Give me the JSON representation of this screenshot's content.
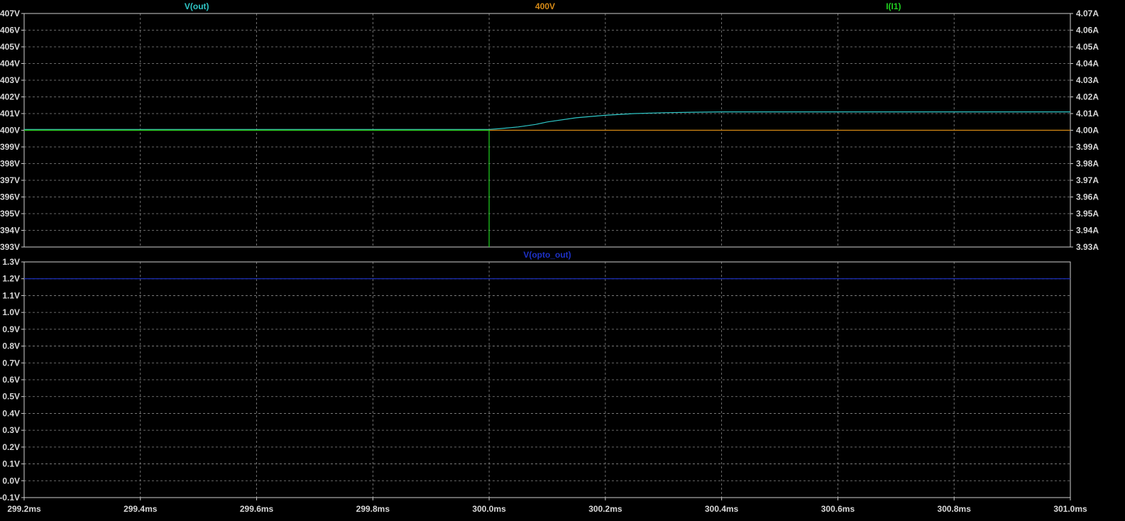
{
  "chart_data": [
    {
      "type": "line",
      "panel": "top",
      "x_unit": "ms",
      "xlim": [
        299.2,
        301.0
      ],
      "ylim_left": [
        393,
        407
      ],
      "ylim_right": [
        3.93,
        4.07
      ],
      "y_ticks_left": [
        "407V",
        "406V",
        "405V",
        "404V",
        "403V",
        "402V",
        "401V",
        "400V",
        "399V",
        "398V",
        "397V",
        "396V",
        "395V",
        "394V",
        "393V"
      ],
      "y_ticks_right": [
        "4.07A",
        "4.06A",
        "4.05A",
        "4.04A",
        "4.03A",
        "4.02A",
        "4.01A",
        "4.00A",
        "3.99A",
        "3.98A",
        "3.97A",
        "3.96A",
        "3.95A",
        "3.94A",
        "3.93A"
      ],
      "grid": true,
      "series": [
        {
          "name": "V(out)",
          "axis": "left",
          "color": "#2fc7c7",
          "x": [
            299.2,
            299.3,
            299.4,
            299.5,
            299.6,
            299.7,
            299.8,
            299.9,
            300.0,
            300.02,
            300.05,
            300.08,
            300.1,
            300.15,
            300.2,
            300.25,
            300.3,
            300.35,
            300.4,
            300.6,
            300.8,
            301.0
          ],
          "y": [
            400.05,
            400.05,
            400.05,
            400.05,
            400.05,
            400.05,
            400.05,
            400.05,
            400.05,
            400.1,
            400.2,
            400.35,
            400.5,
            400.75,
            400.9,
            401.0,
            401.05,
            401.08,
            401.1,
            401.1,
            401.1,
            401.1
          ]
        },
        {
          "name": "400V",
          "axis": "left",
          "color": "#d68a16",
          "x": [
            299.2,
            301.0
          ],
          "y": [
            400,
            400
          ]
        },
        {
          "name": "I(I1)",
          "axis": "right",
          "color": "#20d020",
          "x": [
            299.2,
            300.0,
            300.0,
            300.001,
            300.001
          ],
          "y": [
            4.0,
            4.0,
            3.93,
            3.93,
            3.93
          ]
        }
      ]
    },
    {
      "type": "line",
      "panel": "bottom",
      "x_unit": "ms",
      "xlim": [
        299.2,
        301.0
      ],
      "ylim": [
        -0.1,
        1.3
      ],
      "y_ticks": [
        "1.3V",
        "1.2V",
        "1.1V",
        "1.0V",
        "0.9V",
        "0.8V",
        "0.7V",
        "0.6V",
        "0.5V",
        "0.4V",
        "0.3V",
        "0.2V",
        "0.1V",
        "0.0V",
        "-0.1V"
      ],
      "grid": true,
      "series": [
        {
          "name": "V(opto_out)",
          "axis": "left",
          "color": "#1e32c8",
          "x": [
            299.2,
            301.0
          ],
          "y": [
            1.2,
            1.2
          ]
        }
      ]
    }
  ],
  "x_ticks": [
    "299.2ms",
    "299.4ms",
    "299.6ms",
    "299.8ms",
    "300.0ms",
    "300.2ms",
    "300.4ms",
    "300.6ms",
    "300.8ms",
    "301.0ms"
  ]
}
